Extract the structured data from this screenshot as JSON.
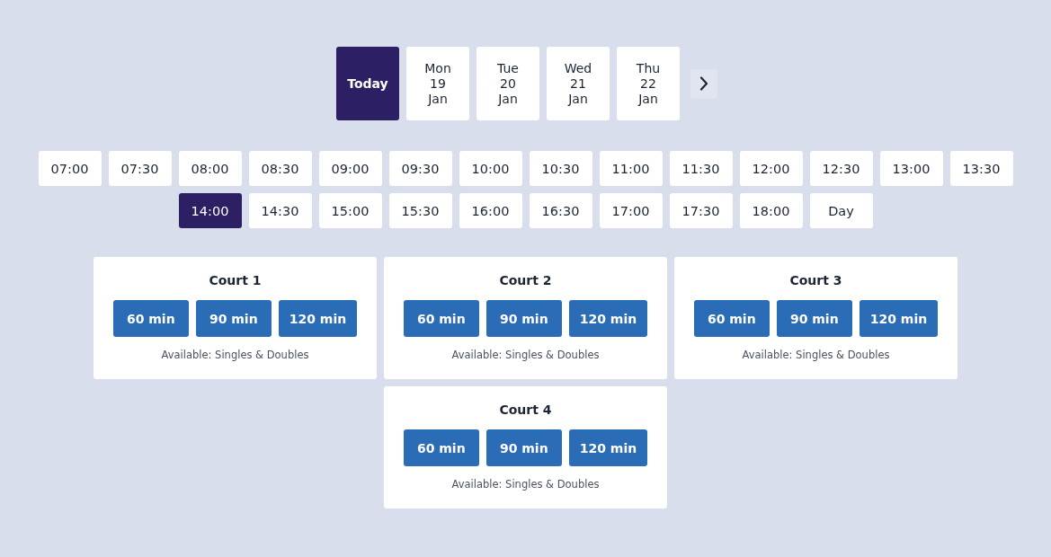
{
  "dates": [
    {
      "lines": [
        "Today"
      ],
      "selected": true
    },
    {
      "lines": [
        "Mon",
        "19",
        "Jan"
      ],
      "selected": false
    },
    {
      "lines": [
        "Tue",
        "20",
        "Jan"
      ],
      "selected": false
    },
    {
      "lines": [
        "Wed",
        "21",
        "Jan"
      ],
      "selected": false
    },
    {
      "lines": [
        "Thu",
        "22",
        "Jan"
      ],
      "selected": false
    }
  ],
  "times": [
    {
      "label": "07:00",
      "selected": false
    },
    {
      "label": "07:30",
      "selected": false
    },
    {
      "label": "08:00",
      "selected": false
    },
    {
      "label": "08:30",
      "selected": false
    },
    {
      "label": "09:00",
      "selected": false
    },
    {
      "label": "09:30",
      "selected": false
    },
    {
      "label": "10:00",
      "selected": false
    },
    {
      "label": "10:30",
      "selected": false
    },
    {
      "label": "11:00",
      "selected": false
    },
    {
      "label": "11:30",
      "selected": false
    },
    {
      "label": "12:00",
      "selected": false
    },
    {
      "label": "12:30",
      "selected": false
    },
    {
      "label": "13:00",
      "selected": false
    },
    {
      "label": "13:30",
      "selected": false
    },
    {
      "label": "14:00",
      "selected": true
    },
    {
      "label": "14:30",
      "selected": false
    },
    {
      "label": "15:00",
      "selected": false
    },
    {
      "label": "15:30",
      "selected": false
    },
    {
      "label": "16:00",
      "selected": false
    },
    {
      "label": "16:30",
      "selected": false
    },
    {
      "label": "17:00",
      "selected": false
    },
    {
      "label": "17:30",
      "selected": false
    },
    {
      "label": "18:00",
      "selected": false
    },
    {
      "label": "Day",
      "selected": false
    }
  ],
  "courts": [
    {
      "name": "Court 1",
      "durations": [
        "60 min",
        "90 min",
        "120 min"
      ],
      "availability": "Available: Singles & Doubles"
    },
    {
      "name": "Court 2",
      "durations": [
        "60 min",
        "90 min",
        "120 min"
      ],
      "availability": "Available: Singles & Doubles"
    },
    {
      "name": "Court 3",
      "durations": [
        "60 min",
        "90 min",
        "120 min"
      ],
      "availability": "Available: Singles & Doubles"
    },
    {
      "name": "Court 4",
      "durations": [
        "60 min",
        "90 min",
        "120 min"
      ],
      "availability": "Available: Singles & Doubles"
    }
  ]
}
